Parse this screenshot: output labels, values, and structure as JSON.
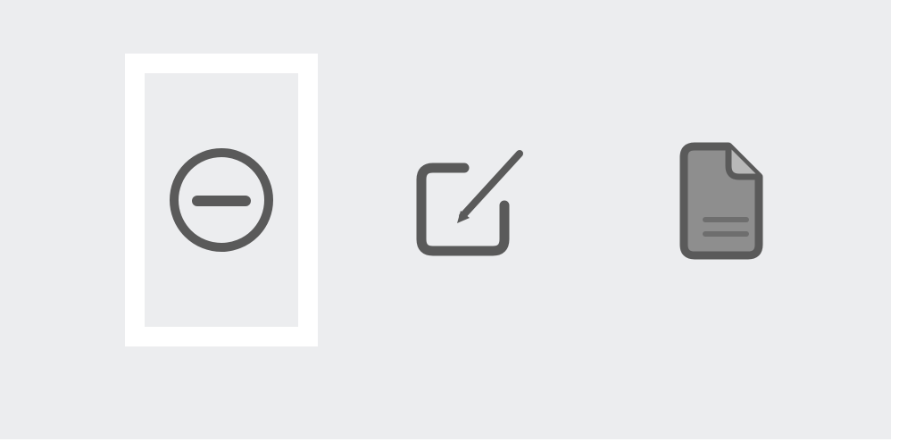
{
  "toolbar": {
    "background_color": "#ecedef",
    "icon_color": "#5a5a5a",
    "selection_color": "#ffffff",
    "buttons": [
      {
        "icon": "minus-circle-icon",
        "selected": true
      },
      {
        "icon": "edit-square-icon",
        "selected": false
      },
      {
        "icon": "document-icon",
        "selected": false
      }
    ]
  }
}
